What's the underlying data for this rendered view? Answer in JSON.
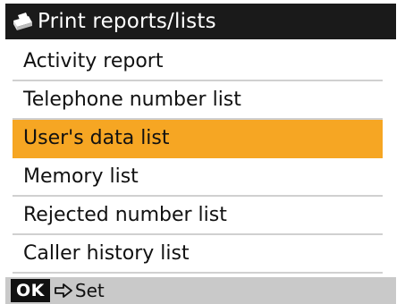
{
  "header": {
    "icon": "printer-icon",
    "title": "Print reports/lists"
  },
  "menu": {
    "selected_index": 2,
    "items": [
      {
        "label": "Activity report"
      },
      {
        "label": "Telephone number list"
      },
      {
        "label": "User's data list"
      },
      {
        "label": "Memory list"
      },
      {
        "label": "Rejected number list"
      },
      {
        "label": "Caller history list"
      }
    ]
  },
  "footer": {
    "ok_key": "OK",
    "arrow_icon": "hollow-arrow-right-icon",
    "action_label": "Set"
  },
  "colors": {
    "title_bg": "#1a1a1a",
    "selected_bg": "#f6a623",
    "footer_bg": "#c9c9c9"
  }
}
